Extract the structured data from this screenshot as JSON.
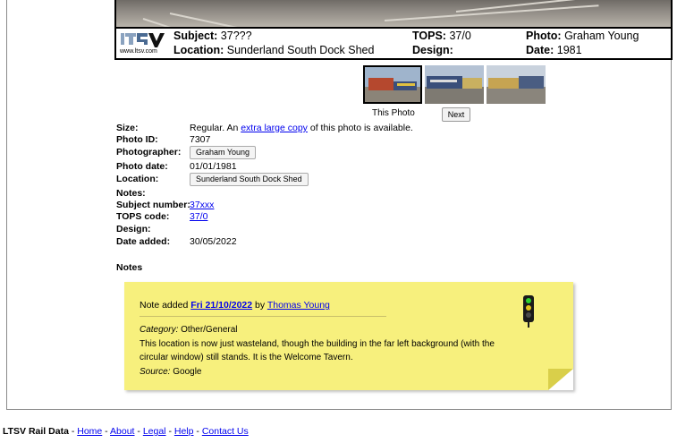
{
  "banner": {
    "logo_url": "www.ltsv.com",
    "subject_label": "Subject:",
    "subject_value": "37???",
    "location_label": "Location:",
    "location_value": "Sunderland South Dock Shed",
    "tops_label": "TOPS:",
    "tops_value": "37/0",
    "design_label": "Design:",
    "design_value": "",
    "photo_label": "Photo:",
    "photo_value": "Graham Young",
    "date_label": "Date:",
    "date_value": "1981"
  },
  "thumbnails": {
    "current_label": "This Photo",
    "next_label": "Next"
  },
  "details": {
    "size_label": "Size:",
    "size_text_before": "Regular. An ",
    "size_link": "extra large copy",
    "size_text_after": " of this photo is available.",
    "photo_id_label": "Photo ID:",
    "photo_id_value": "7307",
    "photographer_label": "Photographer:",
    "photographer_value": "Graham Young",
    "photo_date_label": "Photo date:",
    "photo_date_value": "01/01/1981",
    "location_label": "Location:",
    "location_value": "Sunderland South Dock Shed",
    "notes_label": "Notes:",
    "subject_number_label": "Subject number:",
    "subject_number_value": "37xxx",
    "tops_code_label": "TOPS code:",
    "tops_code_value": "37/0",
    "design_label": "Design:",
    "date_added_label": "Date added:",
    "date_added_value": "30/05/2022"
  },
  "notes_section": {
    "heading": "Notes",
    "note": {
      "prefix": "Note added ",
      "date": "Fri 21/10/2022",
      "by": " by ",
      "author": "Thomas Young",
      "category_label": "Category:",
      "category_value": " Other/General",
      "body_line1": "This location is now just wasteland, though the building in the far left background (with the",
      "body_line2": "circular window) still stands. It is the Welcome Tavern.",
      "source_label": "Source:",
      "source_value": " Google"
    }
  },
  "footer": {
    "site_name": "LTSV Rail Data",
    "sep": " - ",
    "links": [
      "Home",
      "About",
      "Legal",
      "Help",
      "Contact Us"
    ]
  },
  "colors": {
    "note_bg": "#f7f07d",
    "link": "#0000ee",
    "signal_green": "#22c522",
    "signal_yellow": "#e0c020"
  }
}
